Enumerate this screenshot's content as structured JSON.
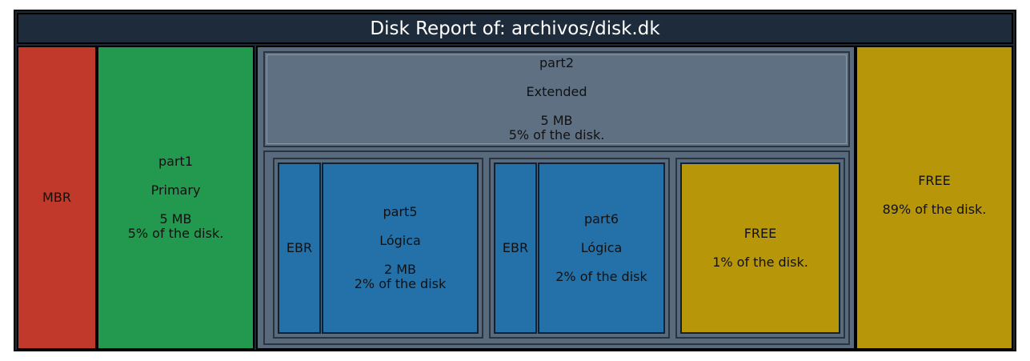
{
  "title": "Disk Report of: archivos/disk.dk",
  "colors": {
    "mbr": "#c0392b",
    "primary": "#23984f",
    "extended": "#5f7083",
    "logical": "#2471a9",
    "free": "#b8960a",
    "header": "#1d2b3b"
  },
  "mbr": {
    "label": "MBR"
  },
  "part1": {
    "name": "part1",
    "type": "Primary",
    "size": "5 MB",
    "percent": "5% of the disk."
  },
  "part2": {
    "name": "part2",
    "type": "Extended",
    "size": "5 MB",
    "percent": "5% of the disk."
  },
  "logical": [
    {
      "ebr": "EBR",
      "name": "part5",
      "type": "Lógica",
      "size": "2 MB",
      "percent": "2% of the disk"
    },
    {
      "ebr": "EBR",
      "name": "part6",
      "type": "Lógica",
      "percent": "2% of the disk"
    }
  ],
  "free_inner": {
    "label": "FREE",
    "percent": "1% of the disk."
  },
  "free_outer": {
    "label": "FREE",
    "percent": "89% of the disk."
  }
}
